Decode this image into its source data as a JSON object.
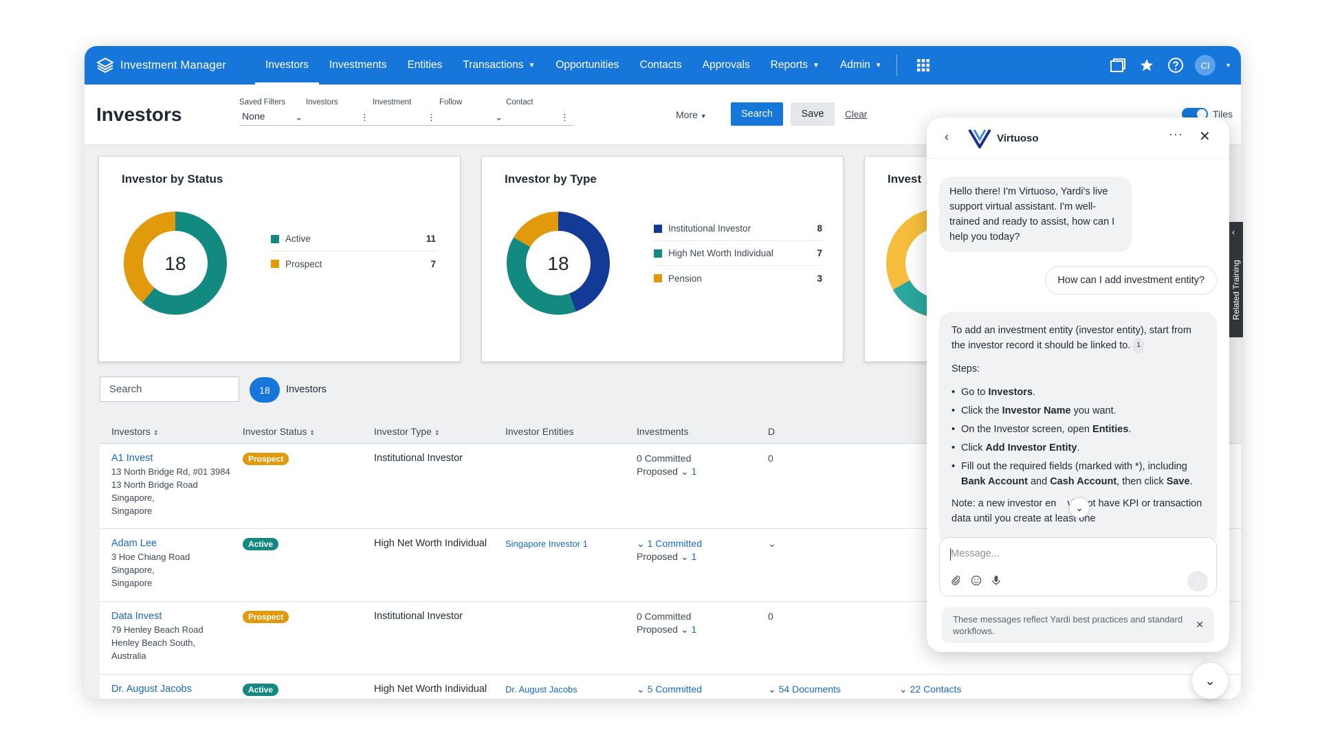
{
  "nav": {
    "brand": "Investment Manager",
    "items": [
      {
        "label": "Investors"
      },
      {
        "label": "Investments"
      },
      {
        "label": "Entities"
      },
      {
        "label": "Transactions"
      },
      {
        "label": "Opportunities"
      },
      {
        "label": "Contacts"
      },
      {
        "label": "Approvals"
      },
      {
        "label": "Reports"
      },
      {
        "label": "Admin"
      }
    ],
    "avatar_initials": "CI"
  },
  "header": {
    "title": "Investors",
    "filters": {
      "saved_filters_label": "Saved Filters",
      "saved_filters_value": "None",
      "investors_label": "Investors",
      "investment_label": "Investment",
      "follow_label": "Follow",
      "contact_label": "Contact"
    },
    "more_label": "More",
    "search_label": "Search",
    "save_label": "Save",
    "clear_label": "Clear",
    "tiles_label": "Tiles"
  },
  "charts": {
    "status_title": "Investor by Status",
    "status_total": "18",
    "type_title": "Investor by Type",
    "type_total": "18",
    "third_title": "Invest",
    "status_legend": [
      {
        "label": "Active",
        "value": "11"
      },
      {
        "label": "Prospect",
        "value": "7"
      }
    ],
    "type_legend": [
      {
        "label": "Institutional Investor",
        "value": "8"
      },
      {
        "label": "High Net Worth Individual",
        "value": "7"
      },
      {
        "label": "Pension",
        "value": "3"
      }
    ]
  },
  "chart_data": [
    {
      "type": "pie",
      "title": "Investor by Status",
      "categories": [
        "Active",
        "Prospect"
      ],
      "values": [
        11,
        7
      ],
      "colors": [
        "#138a80",
        "#e09a0b"
      ],
      "center_label": "18",
      "legend": "right"
    },
    {
      "type": "pie",
      "title": "Investor by Type",
      "categories": [
        "Institutional Investor",
        "High Net Worth Individual",
        "Pension"
      ],
      "values": [
        8,
        7,
        3
      ],
      "colors": [
        "#123a96",
        "#138a80",
        "#e09a0b"
      ],
      "center_label": "18",
      "legend": "right"
    }
  ],
  "colors": {
    "primary": "#1676d9",
    "active": "#138a80",
    "prospect": "#e09a0b",
    "institutional": "#123a96"
  },
  "toolbar": {
    "search_placeholder": "Search",
    "count": "18",
    "count_label": "Investors"
  },
  "table": {
    "headers": [
      "Investors",
      "Investor Status",
      "Investor Type",
      "Investor Entities",
      "Investments",
      "D"
    ],
    "rows": [
      {
        "name": "A1 Invest",
        "address": [
          "13 North Bridge Rd, #01 3984",
          "13 North Bridge Road",
          "Singapore,",
          "Singapore"
        ],
        "status": "Prospect",
        "type": "Institutional Investor",
        "entity": "",
        "committed": "0 Committed",
        "proposed": "Proposed",
        "proposed_count": "1",
        "d": "0"
      },
      {
        "name": "Adam Lee",
        "address": [
          "3 Hoe Chiang Road",
          "Singapore,",
          "Singapore"
        ],
        "status": "Active",
        "type": "High Net Worth Individual",
        "entity": "Singapore Investor 1",
        "committed": "1 Committed",
        "proposed": "Proposed",
        "proposed_count": "1",
        "d": ""
      },
      {
        "name": "Data Invest",
        "address": [
          "79 Henley Beach Road",
          "Henley Beach South,",
          "Australia"
        ],
        "status": "Prospect",
        "type": "Institutional Investor",
        "entity": "",
        "committed": "0 Committed",
        "proposed": "Proposed",
        "proposed_count": "1",
        "d": "0"
      },
      {
        "name": "Dr. August Jacobs",
        "address": [],
        "status": "Active",
        "type": "High Net Worth Individual",
        "entity": "Dr. August Jacobs",
        "committed": "5 Committed",
        "documents": "54 Documents",
        "contacts": "22 Contacts"
      }
    ]
  },
  "chat": {
    "title": "Virtuoso",
    "greeting": "Hello there! I'm Virtuoso, Yardi's live support virtual assistant. I'm well-trained and ready to assist, how can I help you today?",
    "user_message": "How can I add investment entity?",
    "answer_intro": "To add an investment entity (investor entity), start from the investor record it should be linked to.",
    "citation": "1",
    "steps_label": "Steps:",
    "steps": [
      {
        "pre": "Go to ",
        "bold": "Investors",
        "post": "."
      },
      {
        "pre": "Click the ",
        "bold": "Investor Name",
        "post": " you want."
      },
      {
        "pre": "On the Investor screen, open ",
        "bold": "Entities",
        "post": "."
      },
      {
        "pre": "Click ",
        "bold": "Add Investor Entity",
        "post": "."
      },
      {
        "pre": "Fill out the required fields (marked with *), including ",
        "bold": "Bank Account",
        "mid": " and ",
        "bold2": "Cash Account",
        "post": ", then click ",
        "bold3": "Save",
        "post2": "."
      }
    ],
    "note": "Note: a new investor en    vill not have KPI or transaction data until you create at least one",
    "input_placeholder": "Message...",
    "disclaimer": "These messages reflect Yardi best practices and standard workflows."
  },
  "side_tab": {
    "label": "Related Training"
  }
}
